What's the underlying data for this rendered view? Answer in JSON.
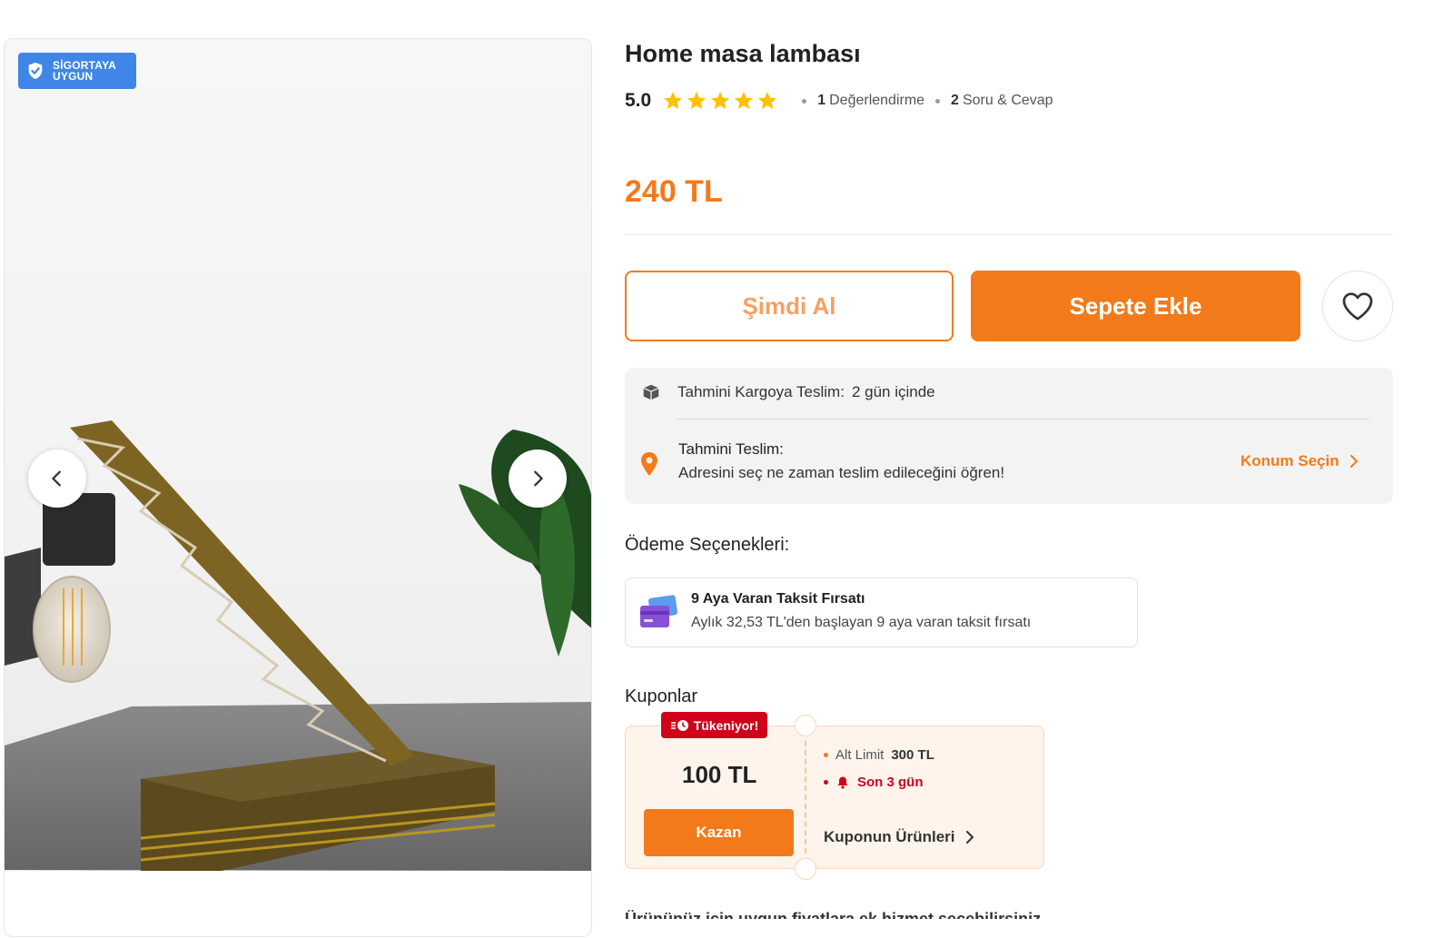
{
  "gallery": {
    "badge": {
      "line1": "SİGORTAYA",
      "line2": "UYGUN",
      "color": "#3f86e6"
    },
    "prev_icon": "chevron-left-icon",
    "next_icon": "chevron-right-icon"
  },
  "product": {
    "brand": "Home",
    "name": "masa lambası",
    "rating_score": "5.0",
    "stars": 5,
    "review_count": "1",
    "review_label": "Değerlendirme",
    "qa_count": "2",
    "qa_label": "Soru & Cevap",
    "price": "240 TL"
  },
  "actions": {
    "buy_now": "Şimdi Al",
    "add_to_cart": "Sepete Ekle",
    "favorite_icon": "heart-icon"
  },
  "delivery": {
    "cargo_label": "Tahmini Kargoya Teslim:",
    "cargo_value": "2 gün içinde",
    "delivery_title": "Tahmini Teslim:",
    "delivery_sub": "Adresini seç ne zaman teslim edileceğini öğren!",
    "location_link": "Konum Seçin"
  },
  "payment": {
    "title": "Ödeme Seçenekleri:",
    "installment_title": "9 Aya Varan Taksit Fırsatı",
    "installment_sub": "Aylık 32,53 TL'den başlayan 9 aya varan taksit fırsatı"
  },
  "coupons": {
    "title": "Kuponlar",
    "tag": "Tükeniyor!",
    "amount": "100 TL",
    "claim_button": "Kazan",
    "limit_label": "Alt Limit",
    "limit_value": "300 TL",
    "days_left": "Son 3 gün",
    "products_link": "Kuponun Ürünleri"
  },
  "bottom_text": "Ürününüz için uygun fiyatlara ek hizmet seçebilirsiniz",
  "colors": {
    "accent": "#f27a1a",
    "alert": "#d0021b",
    "star": "#ffc000"
  }
}
